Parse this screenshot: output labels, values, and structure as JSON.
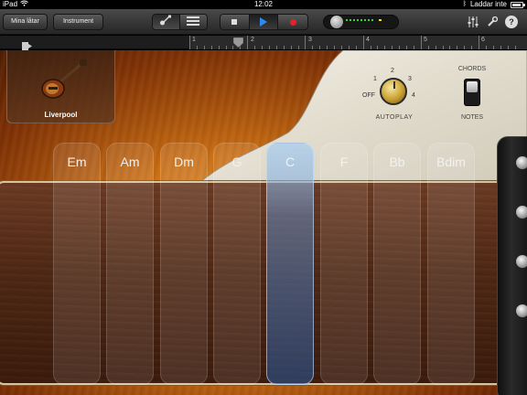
{
  "status": {
    "carrier": "iPad",
    "time": "12:02",
    "battery_text": "Laddar inte",
    "battery_level": 0.85
  },
  "toolbar": {
    "songs_label": "Mina låtar",
    "instrument_label": "Instrument",
    "view_buttons": [
      "guitar-view-icon",
      "tracks-view-icon"
    ],
    "transport": [
      "stop-icon",
      "play-icon",
      "record-icon"
    ],
    "icons": [
      "mixer-icon",
      "wrench-icon",
      "help-icon"
    ],
    "help_glyph": "?"
  },
  "ruler": {
    "numbers": [
      "1",
      "2",
      "3",
      "4",
      "5",
      "6"
    ]
  },
  "instrument": {
    "name": "Liverpool"
  },
  "autoplay": {
    "label": "AUTOPLAY",
    "positions": [
      "OFF",
      "1",
      "2",
      "3",
      "4"
    ],
    "value": "OFF"
  },
  "mode": {
    "top_label": "CHORDS",
    "bottom_label": "NOTES",
    "selected": "CHORDS"
  },
  "chords": {
    "labels": [
      "Em",
      "Am",
      "Dm",
      "G",
      "C",
      "F",
      "Bb",
      "Bdim"
    ],
    "selected": "C"
  },
  "colors": {
    "accent_play": "#2b8cf0",
    "record": "#e0222a",
    "meter_led": "#39d23a"
  }
}
